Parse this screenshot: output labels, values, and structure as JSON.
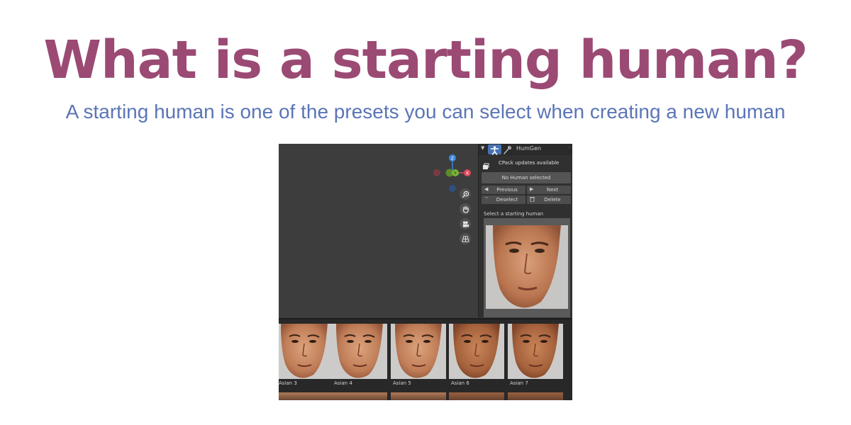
{
  "slide": {
    "title": "What is a starting human?",
    "subtitle": "A starting human is one of the presets you can select when creating a new human"
  },
  "blender": {
    "gizmo_axes": {
      "z": "Z",
      "y": "Y",
      "x": "X"
    },
    "colors": {
      "x_axis": "#e0475d",
      "y_axis": "#7bb33a",
      "z_axis": "#3c86d8",
      "accent": "#4772b3"
    },
    "panel": {
      "tab_label": "HumGen",
      "update_notice": "CPack updates available",
      "status": "No Human selected",
      "previous_label": "Previous",
      "next_label": "Next",
      "deselect_label": "Deselect",
      "delete_label": "Delete",
      "section_label": "Select a starting human"
    },
    "gallery": [
      {
        "label": "Asian 3",
        "skin": "light"
      },
      {
        "label": "Asian 4",
        "skin": "light"
      },
      {
        "label": "Asian 5",
        "skin": "light"
      },
      {
        "label": "Asian 6",
        "skin": "tan"
      },
      {
        "label": "Asian 7",
        "skin": "tan"
      }
    ]
  }
}
